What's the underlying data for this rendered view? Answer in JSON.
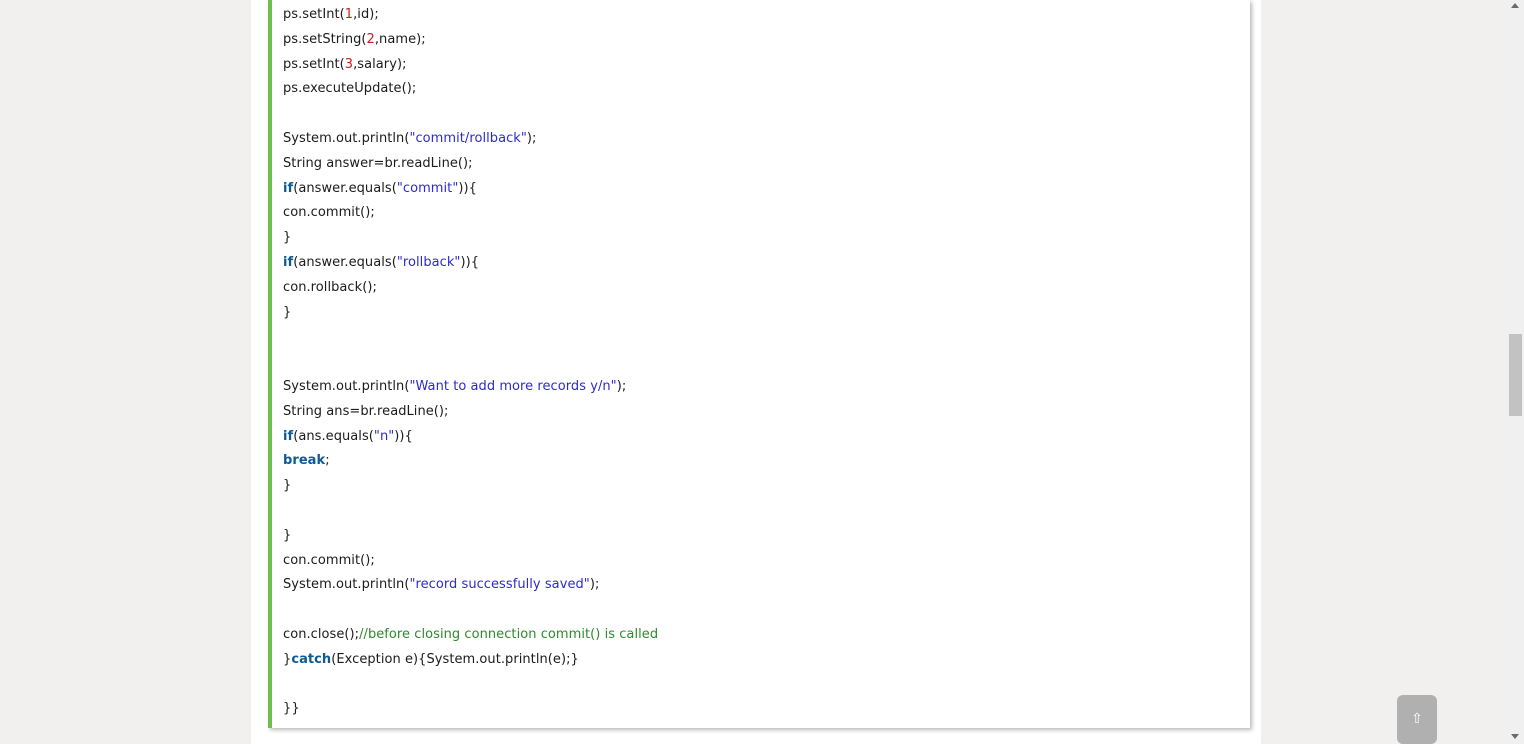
{
  "code_lines": [
    [
      {
        "t": "ps.setInt(",
        "c": ""
      },
      {
        "t": "1",
        "c": "num"
      },
      {
        "t": ",id);",
        "c": ""
      }
    ],
    [
      {
        "t": "ps.setString(",
        "c": ""
      },
      {
        "t": "2",
        "c": "num"
      },
      {
        "t": ",name);",
        "c": ""
      }
    ],
    [
      {
        "t": "ps.setInt(",
        "c": ""
      },
      {
        "t": "3",
        "c": "num"
      },
      {
        "t": ",salary);",
        "c": ""
      }
    ],
    [
      {
        "t": "ps.executeUpdate();",
        "c": ""
      }
    ],
    [],
    [
      {
        "t": "System.out.println(",
        "c": ""
      },
      {
        "t": "\"commit/rollback\"",
        "c": "str"
      },
      {
        "t": ");",
        "c": ""
      }
    ],
    [
      {
        "t": "String answer=br.readLine();",
        "c": ""
      }
    ],
    [
      {
        "t": "if",
        "c": "kw"
      },
      {
        "t": "(answer.equals(",
        "c": ""
      },
      {
        "t": "\"commit\"",
        "c": "str"
      },
      {
        "t": ")){",
        "c": ""
      }
    ],
    [
      {
        "t": "con.commit();",
        "c": ""
      }
    ],
    [
      {
        "t": "}",
        "c": ""
      }
    ],
    [
      {
        "t": "if",
        "c": "kw"
      },
      {
        "t": "(answer.equals(",
        "c": ""
      },
      {
        "t": "\"rollback\"",
        "c": "str"
      },
      {
        "t": ")){",
        "c": ""
      }
    ],
    [
      {
        "t": "con.rollback();",
        "c": ""
      }
    ],
    [
      {
        "t": "}",
        "c": ""
      }
    ],
    [],
    [],
    [
      {
        "t": "System.out.println(",
        "c": ""
      },
      {
        "t": "\"Want to add more records y/n\"",
        "c": "str"
      },
      {
        "t": ");",
        "c": ""
      }
    ],
    [
      {
        "t": "String ans=br.readLine();",
        "c": ""
      }
    ],
    [
      {
        "t": "if",
        "c": "kw"
      },
      {
        "t": "(ans.equals(",
        "c": ""
      },
      {
        "t": "\"n\"",
        "c": "str"
      },
      {
        "t": ")){",
        "c": ""
      }
    ],
    [
      {
        "t": "break",
        "c": "kw"
      },
      {
        "t": ";",
        "c": ""
      }
    ],
    [
      {
        "t": "}",
        "c": ""
      }
    ],
    [],
    [
      {
        "t": "}",
        "c": ""
      }
    ],
    [
      {
        "t": "con.commit();",
        "c": ""
      }
    ],
    [
      {
        "t": "System.out.println(",
        "c": ""
      },
      {
        "t": "\"record successfully saved\"",
        "c": "str"
      },
      {
        "t": ");",
        "c": ""
      }
    ],
    [],
    [
      {
        "t": "con.close();",
        "c": ""
      },
      {
        "t": "//before closing connection commit() is called",
        "c": "com"
      }
    ],
    [
      {
        "t": "}",
        "c": ""
      },
      {
        "t": "catch",
        "c": "kw"
      },
      {
        "t": "(Exception e){System.out.println(e);}",
        "c": ""
      }
    ],
    [],
    [
      {
        "t": "}}",
        "c": ""
      }
    ]
  ],
  "back_to_top": {
    "label": "⇧"
  },
  "scrollbar": {
    "up_icon": "triangle-up",
    "down_icon": "triangle-down",
    "position": 0.45
  }
}
